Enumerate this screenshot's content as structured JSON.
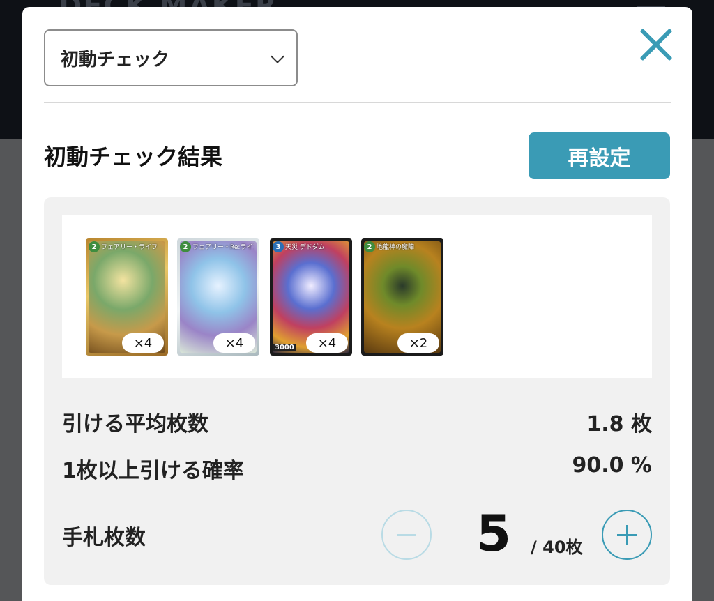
{
  "app": {
    "logo_text": "DECK MAKER"
  },
  "modal": {
    "select_value": "初動チェック",
    "result_title": "初動チェック結果",
    "reset_label": "再設定"
  },
  "cards": [
    {
      "cost": "2",
      "name": "フェアリー・ライフ",
      "quantity": "×4",
      "power": ""
    },
    {
      "cost": "2",
      "name": "フェアリー・Re:ライフ",
      "quantity": "×4",
      "power": ""
    },
    {
      "cost": "3",
      "name": "天災 デドダム",
      "quantity": "×4",
      "power": "3000"
    },
    {
      "cost": "2",
      "name": "地龍神の魔陣",
      "quantity": "×2",
      "power": ""
    }
  ],
  "stats": {
    "avg_label": "引ける平均枚数",
    "avg_value": "1.8 枚",
    "prob_label": "1枚以上引ける確率",
    "prob_value": "90.0 %"
  },
  "hand": {
    "label": "手札枚数",
    "count": "5",
    "total": "/ 40枚"
  },
  "colors": {
    "accent": "#3a9bb5",
    "accent_light": "#b9dbe5",
    "panel_bg": "#f1f1f1"
  },
  "icons": {
    "close": "close-icon",
    "chevron": "chevron-down-icon",
    "minus": "minus-icon",
    "plus": "plus-icon"
  }
}
